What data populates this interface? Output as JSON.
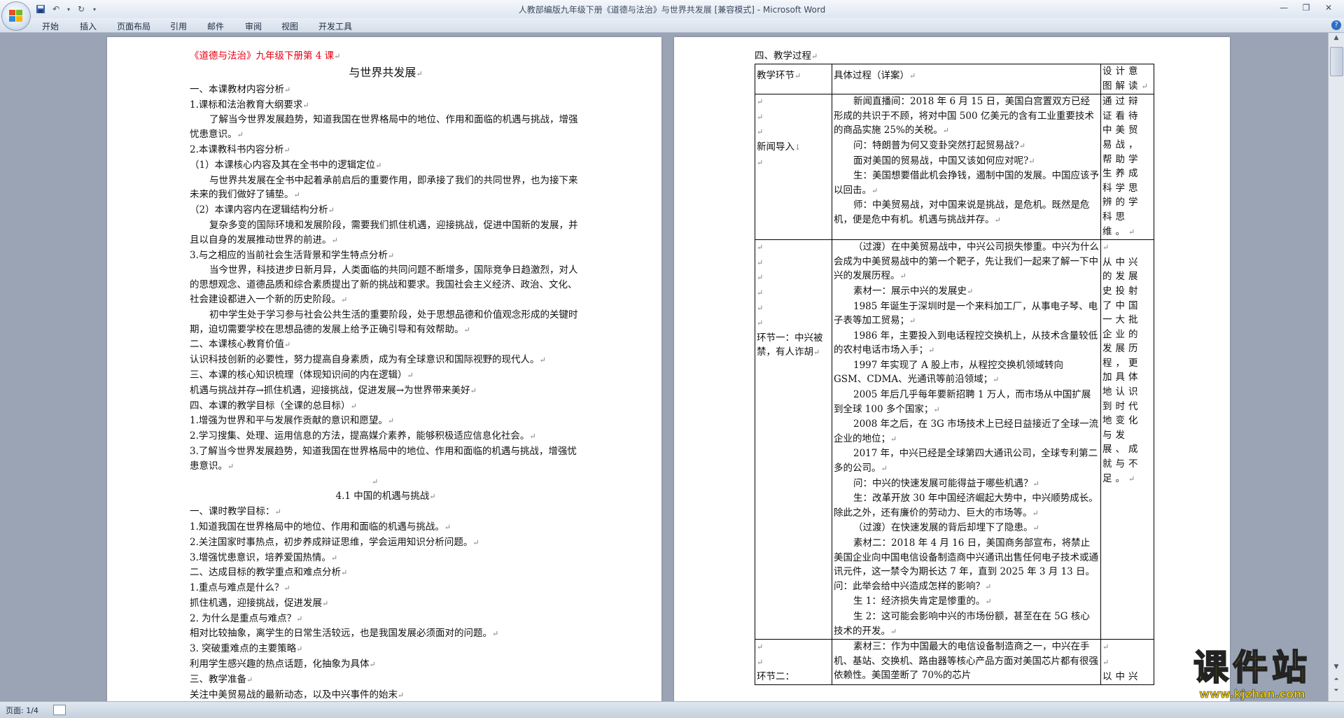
{
  "window": {
    "title": "人教部编版九年级下册《道德与法治》与世界共发展 [兼容模式] - Microsoft Word"
  },
  "ribbon": {
    "tabs": [
      "开始",
      "插入",
      "页面布局",
      "引用",
      "邮件",
      "审阅",
      "视图",
      "开发工具"
    ]
  },
  "status": {
    "page": "页面: 1/4"
  },
  "watermark": {
    "main": "课件站",
    "url": "www.kjzhan.com"
  },
  "icons": {
    "office_button": "office-logo-icon",
    "save": "save-icon",
    "undo": "undo-icon",
    "redo": "redo-icon",
    "customize": "dropdown-icon",
    "help": "help-icon"
  },
  "doc_left": {
    "lines": [
      "《道德与法治》九年级下册第 4 课",
      "与世界共发展",
      "一、本课教材内容分析",
      "1.课标和法治教育大纲要求",
      "了解当今世界发展趋势，知道我国在世界格局中的地位、作用和面临的机遇与挑战，增强忧患意识。",
      "2.本课教科书内容分析",
      "（1）本课核心内容及其在全书中的逻辑定位",
      "与世界共发展在全书中起着承前启后的重要作用，即承接了我们的共同世界，也为接下来未来的我们做好了铺垫。",
      "（2）本课内容内在逻辑结构分析",
      "复杂多变的国际环境和发展阶段，需要我们抓住机遇，迎接挑战，促进中国新的发展，并且以自身的发展推动世界的前进。",
      "3.与之相应的当前社会生活背景和学生特点分析",
      "当今世界，科技进步日新月异，人类面临的共同问题不断增多，国际竞争日趋激烈，对人的思想观念、道德品质和综合素质提出了新的挑战和要求。我国社会主义经济、政治、文化、社会建设都进入一个新的历史阶段。",
      "初中学生处于学习参与社会公共生活的重要阶段，处于思想品德和价值观念形成的关键时期，迫切需要学校在思想品德的发展上给予正确引导和有效帮助。",
      "二、本课核心教育价值",
      "认识科技创新的必要性，努力提高自身素质，成为有全球意识和国际视野的现代人。",
      "三、本课的核心知识梳理（体现知识间的内在逻辑）",
      "机遇与挑战并存→抓住机遇，迎接挑战，促进发展→为世界带来美好",
      "四、本课的教学目标（全课的总目标）",
      "1.增强为世界和平与发展作贡献的意识和愿望。",
      "2.学习搜集、处理、运用信息的方法，提高媒介素养，能够积极适应信息化社会。",
      "3.了解当今世界发展趋势，知道我国在世界格局中的地位、作用和面临的机遇与挑战，增强忧患意识。",
      "4.1  中国的机遇与挑战",
      "一、课时教学目标：",
      "1.知道我国在世界格局中的地位、作用和面临的机遇与挑战。",
      "2.关注国家时事热点，初步养成辩证思维，学会运用知识分析问题。",
      "3.增强忧患意识，培养爱国热情。",
      "二、达成目标的教学重点和难点分析",
      "1.重点与难点是什么？",
      "抓住机遇，迎接挑战，促进发展",
      "2. 为什么是重点与难点？",
      "相对比较抽象，离学生的日常生活较远，也是我国发展必须面对的问题。",
      "3. 突破重难点的主要策略",
      "利用学生感兴趣的热点话题，化抽象为具体",
      "三、教学准备",
      "关注中美贸易战的最新动态，以及中兴事件的始末"
    ]
  },
  "doc_right": {
    "heading": "四、教学过程",
    "table": {
      "headers": [
        "教学环节",
        "具体过程（详案）",
        "设计意图解读"
      ],
      "rows": [
        {
          "stage": "新闻导入",
          "detail": [
            "新闻直播间：2018 年 6 月 15 日，美国白宫置双方已经形成的共识于不顾，将对中国 500 亿美元的含有工业重要技术的商品实施 25%的关税。",
            "问：特朗普为何又变卦突然打起贸易战?",
            "面对美国的贸易战，中国又该如何应对呢?",
            "生：美国想要借此机会挣钱，遏制中国的发展。中国应该予以回击。",
            "师：中美贸易战，对中国来说是挑战，是危机。既然是危机，便是危中有机。机遇与挑战并存。"
          ],
          "intent": "通过辩证看待中美贸易战，帮助学生养成科学思辨的学科思维。"
        },
        {
          "stage": "环节一：中兴被禁，有人诈胡",
          "detail": [
            "（过渡）在中美贸易战中，中兴公司损失惨重。中兴为什么会成为中美贸易战中的第一个靶子，先让我们一起来了解一下中兴的发展历程。",
            "素材一：展示中兴的发展史",
            "1985 年诞生于深圳时是一个来料加工厂，从事电子琴、电子表等加工贸易；",
            "1986 年，主要投入到电话程控交换机上，从技术含量较低的农村电话市场入手；",
            "1997 年实现了 A 股上市，从程控交换机领域转向 GSM、CDMA、光通讯等前沿领域；",
            "2005 年后几乎每年要新招聘 1 万人，而市场从中国扩展到全球 100 多个国家；",
            "2008 年之后，在 3G 市场技术上已经日益接近了全球一流企业的地位；",
            "2017 年，中兴已经是全球第四大通讯公司，全球专利第二多的公司。",
            "问：中兴的快速发展可能得益于哪些机遇？",
            "生：改革开放 30 年中国经济崛起大势中，中兴顺势成长。除此之外，还有廉价的劳动力、巨大的市场等。",
            "（过渡）在快速发展的背后却埋下了隐患。",
            "素材二：2018 年 4 月 16 日，美国商务部宣布，将禁止美国企业向中国电信设备制造商中兴通讯出售任何电子技术或通讯元件，这一禁令为期长达 7 年，直到 2025 年 3 月 13 日。问：此举会给中兴造成怎样的影响？",
            "生 1：经济损失肯定是惨重的。",
            "生 2：这可能会影响中兴的市场份额，甚至在在 5G 核心技术的开发。"
          ],
          "intent": "从中兴的发展史投射了中国一大批企业的发展历程，更加具体地认识到时代地变化与发展、成就与不足。"
        },
        {
          "stage": "环节二：",
          "detail": [
            "素材三：作为中国最大的电信设备制造商之一，中兴在手机、基站、交换机、路由器等核心产品方面对美国芯片都有很强依赖性。美国垄断了 70%的芯片"
          ],
          "intent": "以中兴"
        }
      ]
    }
  }
}
